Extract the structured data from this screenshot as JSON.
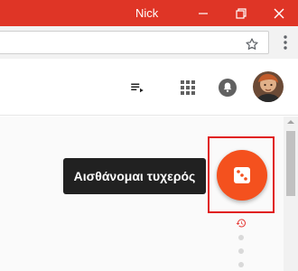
{
  "window": {
    "user_name": "Nick",
    "controls": [
      "minimize-icon",
      "restore-icon",
      "close-icon"
    ]
  },
  "toolbar": {
    "address_value": "",
    "icons": [
      "star-icon",
      "more-vertical-icon"
    ]
  },
  "header": {
    "icons": [
      "queue-music-icon",
      "apps-grid-icon",
      "notifications-bell-icon"
    ],
    "avatar": "user-avatar"
  },
  "main": {
    "lucky_tooltip": "Αισθάνομαι τυχερός",
    "lucky_button_icon": "dice-icon",
    "history_icon": "history-icon",
    "pager_dots": 3
  },
  "colors": {
    "titlebar": "#df3526",
    "fab": "#f4511e",
    "tooltip_bg": "#212121",
    "highlight_frame": "#e01b1b"
  }
}
